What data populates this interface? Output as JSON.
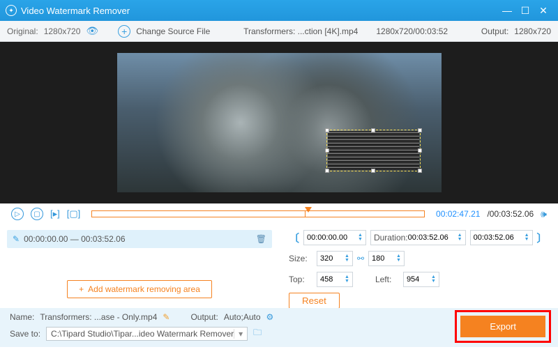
{
  "titlebar": {
    "title": "Video Watermark Remover"
  },
  "toolbar": {
    "original_label": "Original:",
    "original_res": "1280x720",
    "change_source": "Change Source File",
    "filename": "Transformers: ...ction [4K].mp4",
    "fileinfo": "1280x720/00:03:52",
    "output_label": "Output:",
    "output_res": "1280x720"
  },
  "controls": {
    "current": "00:02:47.21",
    "total": "/00:03:52.06"
  },
  "segment": {
    "range": "00:00:00.00 — 00:03:52.06"
  },
  "add_area": "Add watermark removing area",
  "trim": {
    "start": "00:00:00.00",
    "duration_label": "Duration:",
    "duration": "00:03:52.06",
    "end": "00:03:52.06"
  },
  "size": {
    "label": "Size:",
    "w": "320",
    "h": "180"
  },
  "pos": {
    "top_label": "Top:",
    "top": "458",
    "left_label": "Left:",
    "left": "954"
  },
  "reset": "Reset",
  "bottom": {
    "name_label": "Name:",
    "name": "Transformers: ...ase - Only.mp4",
    "output_label": "Output:",
    "output": "Auto;Auto",
    "save_label": "Save to:",
    "save_path": "C:\\Tipard Studio\\Tipar...ideo Watermark Remover"
  },
  "export": "Export"
}
